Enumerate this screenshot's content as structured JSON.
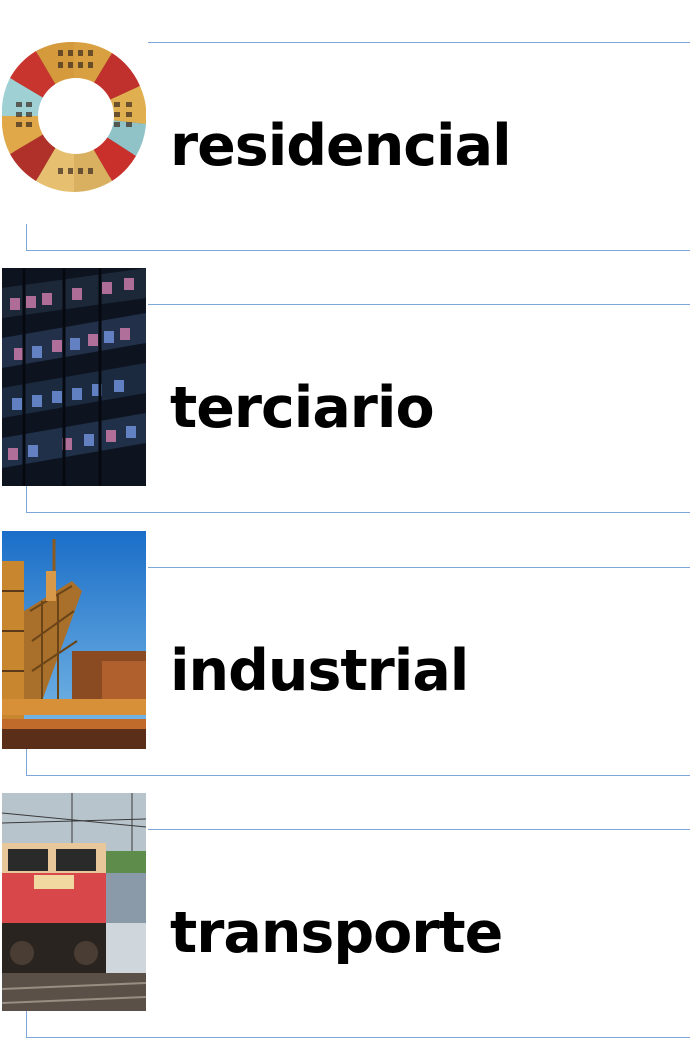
{
  "categories": [
    {
      "label": "residencial",
      "image": "residential-buildings-circular-photo"
    },
    {
      "label": "terciario",
      "image": "office-building-night-photo"
    },
    {
      "label": "industrial",
      "image": "industrial-plant-photo"
    },
    {
      "label": "transporte",
      "image": "locomotive-train-photo"
    }
  ],
  "colors": {
    "line": "#7fa6d8",
    "text": "#000000",
    "background": "#ffffff"
  }
}
